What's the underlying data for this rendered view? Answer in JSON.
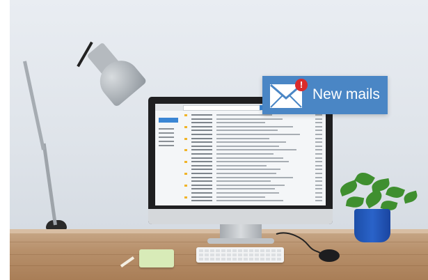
{
  "notification": {
    "text": "New mails",
    "badge": "!",
    "icon": "envelope-icon",
    "banner_color": "#4a86c5",
    "badge_color": "#d92b2b"
  },
  "scene": {
    "wall_color": "#e3e8ee",
    "desk_color": "#b8916c",
    "pot_color": "#2a63c9"
  }
}
